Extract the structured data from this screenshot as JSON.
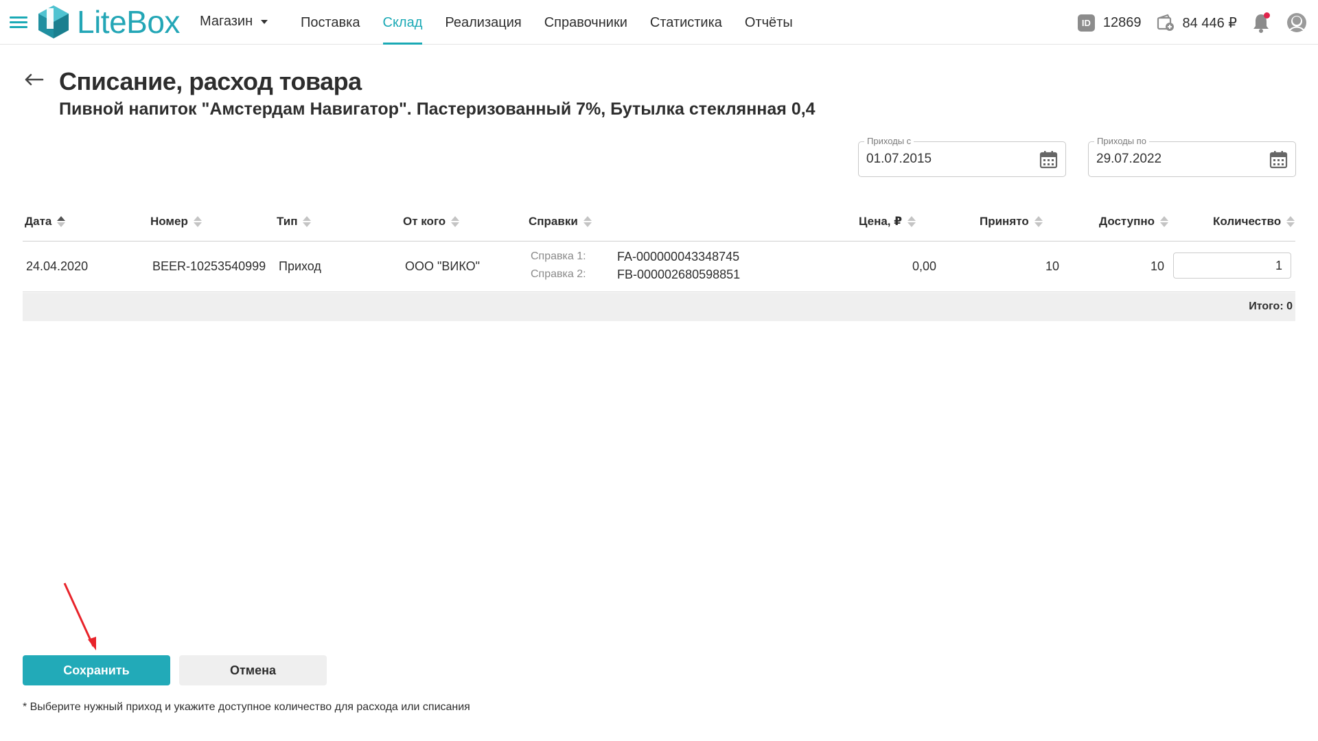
{
  "app": {
    "logo_text": "LiteBox",
    "store_label": "Магазин",
    "nav": [
      "Поставка",
      "Склад",
      "Реализация",
      "Справочники",
      "Статистика",
      "Отчёты"
    ],
    "active_nav": "Склад",
    "account_id_badge": "ID",
    "account_id": "12869",
    "balance": "84 446 ₽",
    "accent_color": "#1aa9b5",
    "icons": [
      "menu-icon",
      "id-icon",
      "wallet-icon",
      "bell-icon",
      "user-icon"
    ]
  },
  "page": {
    "title": "Списание, расход товара",
    "subtitle": "Пивной напиток \"Амстердам Навигатор\". Пастеризованный 7%, Бутылка стеклянная 0,4"
  },
  "filters": {
    "from_label": "Приходы с",
    "from_value": "01.07.2015",
    "to_label": "Приходы по",
    "to_value": "29.07.2022"
  },
  "table": {
    "headers": {
      "date": "Дата",
      "number": "Номер",
      "type": "Тип",
      "from": "От кого",
      "refs": "Справки",
      "price": "Цена, ₽",
      "received": "Принято",
      "available": "Доступно",
      "quantity": "Количество"
    },
    "rows": [
      {
        "date": "24.04.2020",
        "number": "BEER-10253540999",
        "type": "Приход",
        "from": "ООО \"ВИКО\"",
        "ref1_label": "Справка 1:",
        "ref1_value": "FA-000000043348745",
        "ref2_label": "Справка 2:",
        "ref2_value": "FB-000002680598851",
        "price": "0,00",
        "received": "10",
        "available": "10",
        "quantity": "1"
      }
    ],
    "total_text": "Итого: 0"
  },
  "actions": {
    "save_label": "Сохранить",
    "cancel_label": "Отмена"
  },
  "footnote": "* Выберите нужный приход и укажите доступное количество для расхода или списания"
}
